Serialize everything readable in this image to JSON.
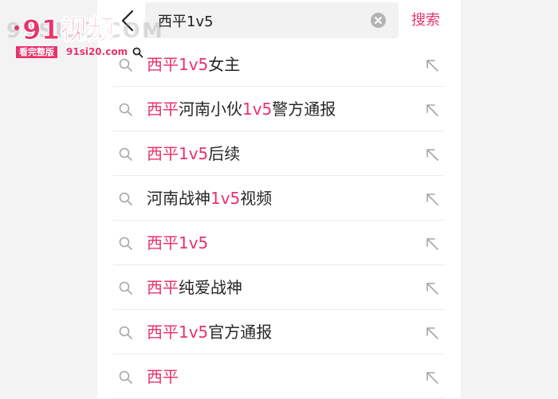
{
  "search": {
    "query": "西平1v5",
    "submit_label": "搜索"
  },
  "suggestions": [
    {
      "parts": [
        {
          "t": "西平",
          "hl": true
        },
        {
          "t": "1v5",
          "hl": true
        },
        {
          "t": "女主",
          "hl": false
        }
      ]
    },
    {
      "parts": [
        {
          "t": "西平",
          "hl": true
        },
        {
          "t": "河南小伙",
          "hl": false
        },
        {
          "t": "1v5",
          "hl": true
        },
        {
          "t": "警方通报",
          "hl": false
        }
      ]
    },
    {
      "parts": [
        {
          "t": "西平",
          "hl": true
        },
        {
          "t": "1v5",
          "hl": true
        },
        {
          "t": "后续",
          "hl": false
        }
      ]
    },
    {
      "parts": [
        {
          "t": "河南战神",
          "hl": false
        },
        {
          "t": "1v5",
          "hl": true
        },
        {
          "t": "视频",
          "hl": false
        }
      ]
    },
    {
      "parts": [
        {
          "t": "西平",
          "hl": true
        },
        {
          "t": "1v5",
          "hl": true
        }
      ]
    },
    {
      "parts": [
        {
          "t": "西平",
          "hl": true
        },
        {
          "t": "纯爱战神",
          "hl": false
        }
      ]
    },
    {
      "parts": [
        {
          "t": "西平",
          "hl": true
        },
        {
          "t": "1v5",
          "hl": true
        },
        {
          "t": "官方通报",
          "hl": false
        }
      ]
    },
    {
      "parts": [
        {
          "t": "西平",
          "hl": true
        }
      ]
    }
  ],
  "watermark": {
    "site_text": "91SI20.COM",
    "brand": "91视频",
    "badge": "看完整版",
    "url": "91si20.com"
  },
  "colors": {
    "accent": "#e8336a",
    "text": "#262626",
    "icon": "#a6a6a6"
  }
}
